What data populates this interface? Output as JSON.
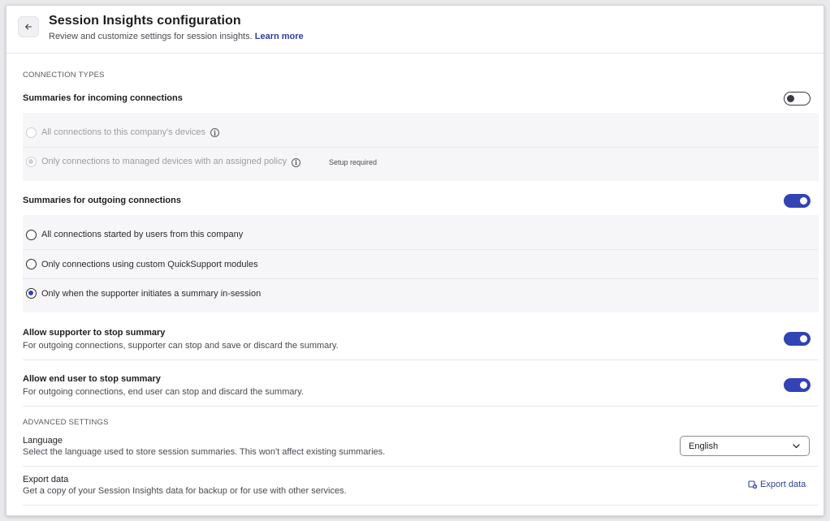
{
  "header": {
    "title": "Session Insights configuration",
    "subtitle": "Review and customize settings for session insights.",
    "learn_more": "Learn more",
    "back_icon": "arrow-left-icon"
  },
  "connection_types": {
    "section_label": "CONNECTION TYPES",
    "incoming": {
      "title": "Summaries for incoming connections",
      "enabled": false,
      "options": [
        {
          "label": "All connections to this company's devices",
          "checked": false,
          "disabled": true,
          "info": true
        },
        {
          "label": "Only connections to managed devices with an assigned policy",
          "checked": true,
          "disabled": true,
          "info": true,
          "badge": "Setup required"
        }
      ]
    },
    "outgoing": {
      "title": "Summaries for outgoing connections",
      "enabled": true,
      "options": [
        {
          "label": "All connections started by users from this company",
          "checked": false
        },
        {
          "label": "Only connections using custom QuickSupport modules",
          "checked": false
        },
        {
          "label": "Only when the supporter initiates a summary in-session",
          "checked": true
        }
      ]
    },
    "supporter_stop": {
      "title": "Allow supporter to stop summary",
      "description": "For outgoing connections, supporter can stop and save or discard the summary.",
      "enabled": true
    },
    "end_user_stop": {
      "title": "Allow end user to stop summary",
      "description": "For outgoing connections, end user can stop and discard the summary.",
      "enabled": true
    }
  },
  "advanced": {
    "section_label": "ADVANCED SETTINGS",
    "language": {
      "title": "Language",
      "description": "Select the language used to store session summaries. This won't affect existing summaries.",
      "selected": "English"
    },
    "export": {
      "title": "Export data",
      "description": "Get a copy of your Session Insights data for backup or for use with other services.",
      "link": "Export data",
      "icon": "export-data-icon"
    }
  },
  "colors": {
    "accent": "#3243b6",
    "link": "#2c3fa3",
    "panel_bg": "#f6f6f8"
  }
}
